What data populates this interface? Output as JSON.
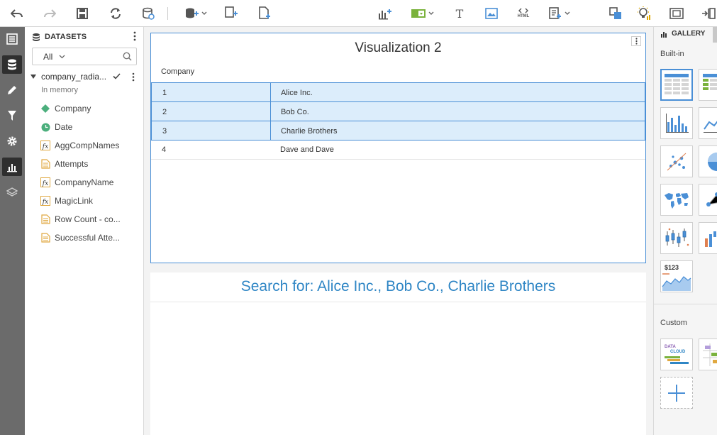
{
  "datasets_panel": {
    "title": "DATASETS",
    "filter_value": "All",
    "source": {
      "name": "company_radia...",
      "status": "In memory"
    },
    "fields": [
      {
        "label": "Company",
        "icon": "dimension-icon"
      },
      {
        "label": "Date",
        "icon": "date-icon"
      },
      {
        "label": "AggCompNames",
        "icon": "formula-icon"
      },
      {
        "label": "Attempts",
        "icon": "measure-icon"
      },
      {
        "label": "CompanyName",
        "icon": "formula-icon"
      },
      {
        "label": "MagicLink",
        "icon": "formula-icon"
      },
      {
        "label": "Row Count - co...",
        "icon": "measure-icon"
      },
      {
        "label": "Successful Atte...",
        "icon": "measure-icon"
      }
    ]
  },
  "visualization": {
    "title": "Visualization 2",
    "column_header": "Company",
    "rows": [
      {
        "index": "1",
        "value": "Alice Inc.",
        "selected": true
      },
      {
        "index": "2",
        "value": "Bob Co.",
        "selected": true
      },
      {
        "index": "3",
        "value": "Charlie Brothers",
        "selected": true
      },
      {
        "index": "4",
        "value": "Dave and Dave",
        "selected": false
      }
    ]
  },
  "search_card": {
    "title": "Search for: Alice Inc., Bob Co., Charlie Brothers"
  },
  "gallery": {
    "title": "GALLERY",
    "builtin_label": "Built-in",
    "custom_label": "Custom",
    "kpi_label": "$123",
    "custom_tile_text": [
      "DATA",
      "CLOUD"
    ]
  },
  "toolbar": {
    "html_label": "HTML"
  },
  "colors": {
    "accent": "#4a8fd6",
    "search_title": "#2f86c5",
    "rail": "#6b6b6b"
  }
}
